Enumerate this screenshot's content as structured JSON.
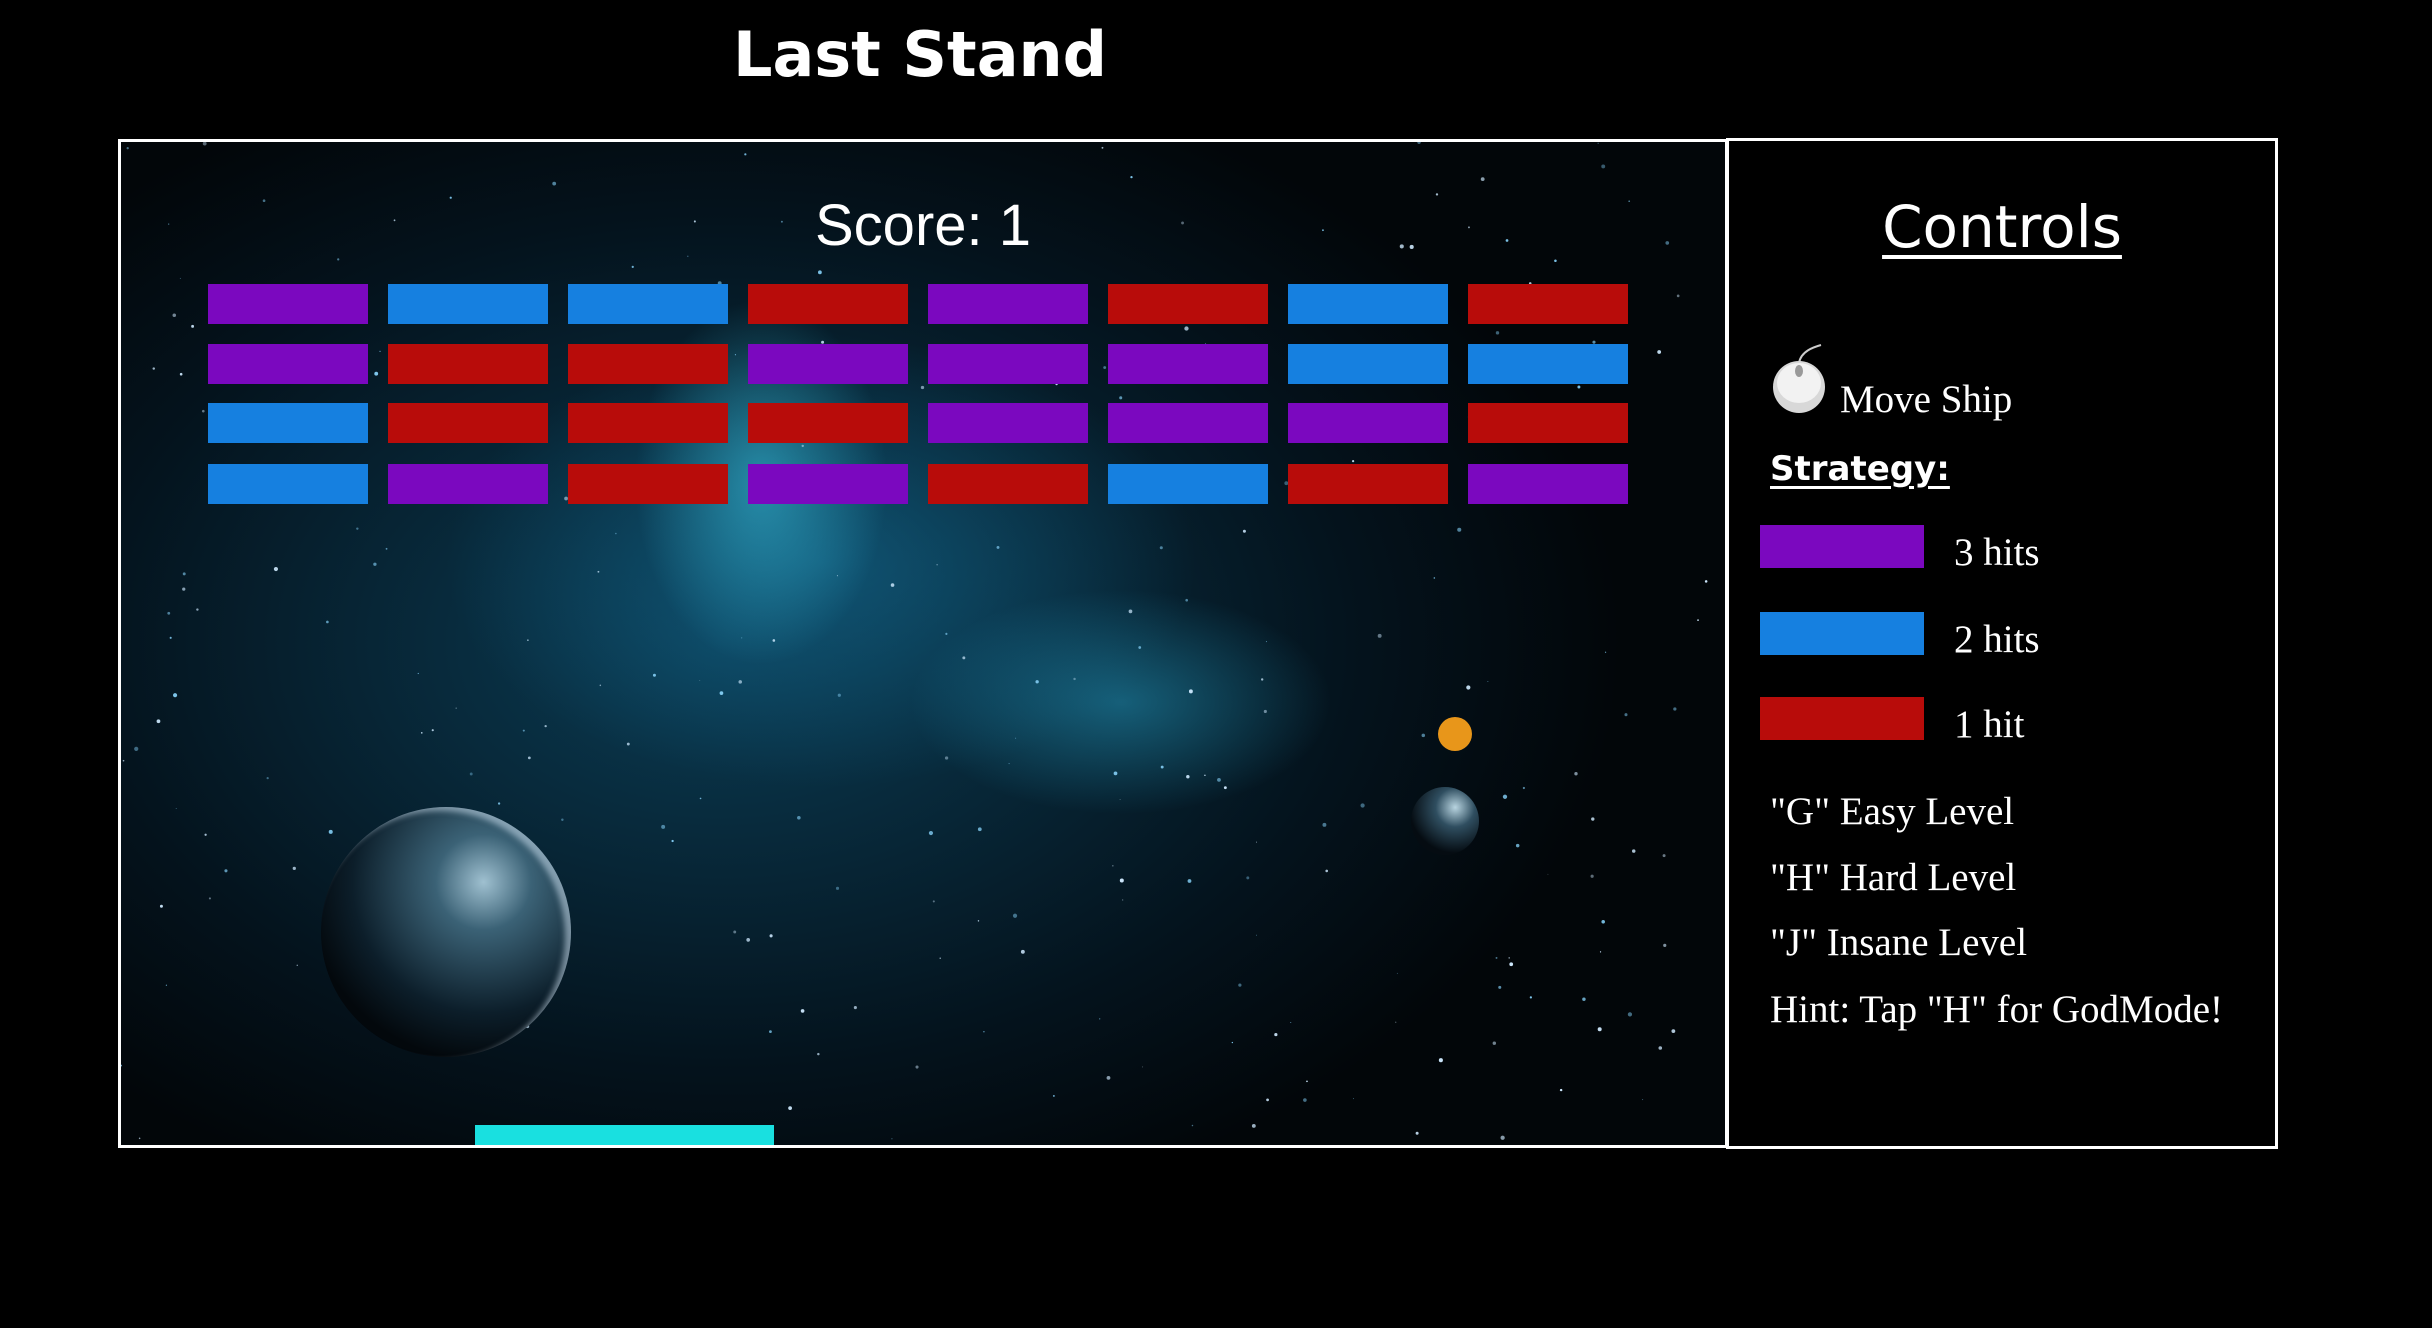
{
  "page": {
    "title": "Last Stand"
  },
  "game": {
    "score_text": "Score: 1",
    "colors": {
      "purple": "#7b08bf",
      "blue": "#1680e0",
      "red": "#b80c0a",
      "paddle": "#19e0e0",
      "ball": "#e8961a"
    },
    "bricks": [
      [
        "purple",
        "blue",
        "blue",
        "red",
        "purple",
        "red",
        "blue",
        "red"
      ],
      [
        "purple",
        "red",
        "red",
        "purple",
        "purple",
        "purple",
        "blue",
        "blue"
      ],
      [
        "blue",
        "red",
        "red",
        "red",
        "purple",
        "purple",
        "purple",
        "red"
      ],
      [
        "blue",
        "purple",
        "red",
        "purple",
        "red",
        "blue",
        "red",
        "purple"
      ]
    ]
  },
  "controls": {
    "title": "Controls",
    "mouse_icon": "mouse-icon",
    "move_label": "Move Ship",
    "strategy_label": "Strategy:",
    "legend": [
      {
        "color": "#7b08bf",
        "label": "3 hits"
      },
      {
        "color": "#1680e0",
        "label": "2 hits"
      },
      {
        "color": "#b80c0a",
        "label": "1 hit"
      }
    ],
    "lines": [
      "\"G\" Easy Level",
      "\"H\" Hard Level",
      "\"J\" Insane Level",
      "Hint: Tap \"H\" for GodMode!"
    ]
  }
}
